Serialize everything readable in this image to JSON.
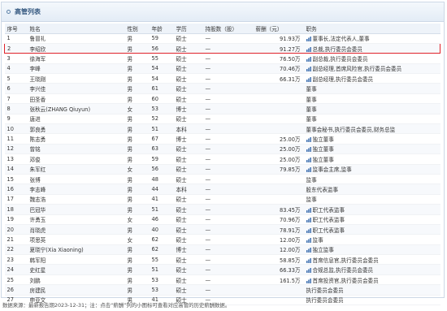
{
  "panel_title": "高管列表",
  "columns": [
    "序号",
    "姓名",
    "性别",
    "年龄",
    "学历",
    "持股数（股）",
    "薪酬（元）",
    "职务"
  ],
  "rows": [
    {
      "no": "1",
      "name": "鲁冒礼",
      "gender": "男",
      "age": "59",
      "edu": "硕士",
      "shares": "—",
      "salary": "91.93万",
      "salary_icon": true,
      "title": "董事长,法定代表人,董事"
    },
    {
      "no": "2",
      "name": "李绍欣",
      "gender": "男",
      "age": "56",
      "edu": "硕士",
      "shares": "—",
      "salary": "91.27万",
      "salary_icon": true,
      "title": "总裁,执行委员会委员",
      "highlight": true
    },
    {
      "no": "3",
      "name": "徐海军",
      "gender": "男",
      "age": "55",
      "edu": "硕士",
      "shares": "—",
      "salary": "76.50万",
      "salary_icon": true,
      "title": "副总裁,执行委员会委员"
    },
    {
      "no": "4",
      "name": "李峰",
      "gender": "男",
      "age": "54",
      "edu": "硕士",
      "shares": "—",
      "salary": "70.46万",
      "salary_icon": true,
      "title": "副总经理,首席风险官,执行委员会委员"
    },
    {
      "no": "5",
      "name": "王晓刚",
      "gender": "男",
      "age": "54",
      "edu": "硕士",
      "shares": "—",
      "salary": "66.31万",
      "salary_icon": true,
      "title": "副总经理,执行委员会委员"
    },
    {
      "no": "6",
      "name": "李兴佳",
      "gender": "男",
      "age": "61",
      "edu": "硕士",
      "shares": "—",
      "salary": "",
      "salary_icon": false,
      "title": "董事"
    },
    {
      "no": "7",
      "name": "田圣香",
      "gender": "男",
      "age": "60",
      "edu": "硕士",
      "shares": "—",
      "salary": "",
      "salary_icon": false,
      "title": "董事"
    },
    {
      "no": "8",
      "name": "张秋云(ZHANG Qiuyun)",
      "gender": "女",
      "age": "53",
      "edu": "博士",
      "shares": "—",
      "salary": "",
      "salary_icon": false,
      "title": "董事"
    },
    {
      "no": "9",
      "name": "唐进",
      "gender": "男",
      "age": "52",
      "edu": "硕士",
      "shares": "—",
      "salary": "",
      "salary_icon": false,
      "title": "董事"
    },
    {
      "no": "10",
      "name": "郭良勇",
      "gender": "男",
      "age": "51",
      "edu": "本科",
      "shares": "—",
      "salary": "",
      "salary_icon": false,
      "title": "董事会秘书,执行委员会委员,财务总监"
    },
    {
      "no": "11",
      "name": "陈志勇",
      "gender": "男",
      "age": "67",
      "edu": "博士",
      "shares": "—",
      "salary": "25.00万",
      "salary_icon": true,
      "title": "独立董事"
    },
    {
      "no": "12",
      "name": "曾铭",
      "gender": "男",
      "age": "63",
      "edu": "硕士",
      "shares": "—",
      "salary": "25.00万",
      "salary_icon": true,
      "title": "独立董事"
    },
    {
      "no": "13",
      "name": "邓俊",
      "gender": "男",
      "age": "59",
      "edu": "硕士",
      "shares": "—",
      "salary": "25.00万",
      "salary_icon": true,
      "title": "独立董事"
    },
    {
      "no": "14",
      "name": "朱军红",
      "gender": "女",
      "age": "56",
      "edu": "硕士",
      "shares": "—",
      "salary": "79.85万",
      "salary_icon": true,
      "title": "监事会主席,监事"
    },
    {
      "no": "15",
      "name": "张博",
      "gender": "男",
      "age": "48",
      "edu": "硕士",
      "shares": "—",
      "salary": "",
      "salary_icon": false,
      "title": "监事"
    },
    {
      "no": "16",
      "name": "李志峰",
      "gender": "男",
      "age": "44",
      "edu": "本科",
      "shares": "—",
      "salary": "",
      "salary_icon": false,
      "title": "股东代表监事"
    },
    {
      "no": "17",
      "name": "魏志浩",
      "gender": "男",
      "age": "41",
      "edu": "硕士",
      "shares": "—",
      "salary": "",
      "salary_icon": false,
      "title": "监事"
    },
    {
      "no": "18",
      "name": "巴冠华",
      "gender": "男",
      "age": "51",
      "edu": "硕士",
      "shares": "—",
      "salary": "83.45万",
      "salary_icon": true,
      "title": "职工代表监事"
    },
    {
      "no": "19",
      "name": "许勇玉",
      "gender": "女",
      "age": "46",
      "edu": "硕士",
      "shares": "—",
      "salary": "70.96万",
      "salary_icon": true,
      "title": "职工代表监事"
    },
    {
      "no": "20",
      "name": "肖晓虎",
      "gender": "男",
      "age": "40",
      "edu": "硕士",
      "shares": "—",
      "salary": "78.91万",
      "salary_icon": true,
      "title": "职工代表监事"
    },
    {
      "no": "21",
      "name": "项思英",
      "gender": "女",
      "age": "62",
      "edu": "硕士",
      "shares": "—",
      "salary": "12.00万",
      "salary_icon": true,
      "title": "监事"
    },
    {
      "no": "22",
      "name": "夏晓宁(Xia Xiaoning)",
      "gender": "男",
      "age": "62",
      "edu": "博士",
      "shares": "—",
      "salary": "12.00万",
      "salary_icon": true,
      "title": "独立监事"
    },
    {
      "no": "23",
      "name": "韩军阳",
      "gender": "男",
      "age": "55",
      "edu": "硕士",
      "shares": "—",
      "salary": "58.85万",
      "salary_icon": true,
      "title": "首席信息官,执行委员会委员"
    },
    {
      "no": "24",
      "name": "史红星",
      "gender": "男",
      "age": "51",
      "edu": "硕士",
      "shares": "—",
      "salary": "66.33万",
      "salary_icon": true,
      "title": "合规总监,执行委员会委员"
    },
    {
      "no": "25",
      "name": "刘鹏",
      "gender": "男",
      "age": "53",
      "edu": "硕士",
      "shares": "—",
      "salary": "161.5万",
      "salary_icon": true,
      "title": "首席投资官,执行委员会委员"
    },
    {
      "no": "26",
      "name": "房建民",
      "gender": "男",
      "age": "53",
      "edu": "硕士",
      "shares": "—",
      "salary": "",
      "salary_icon": false,
      "title": "执行委员会委员"
    },
    {
      "no": "27",
      "name": "申亚文",
      "gender": "男",
      "age": "41",
      "edu": "硕士",
      "shares": "—",
      "salary": "",
      "salary_icon": false,
      "title": "执行委员会委员"
    }
  ],
  "footer": "数据来源：最新报告期2023-12-31；注：点击“薪酬”列的小图标可查看对应高管的历史薪酬数据。",
  "colors": {
    "icon_blue": "#3d6fb0",
    "highlight": "#e0232b",
    "header_bg": "#eef3f9"
  },
  "icon_name": "bar-chart-icon"
}
